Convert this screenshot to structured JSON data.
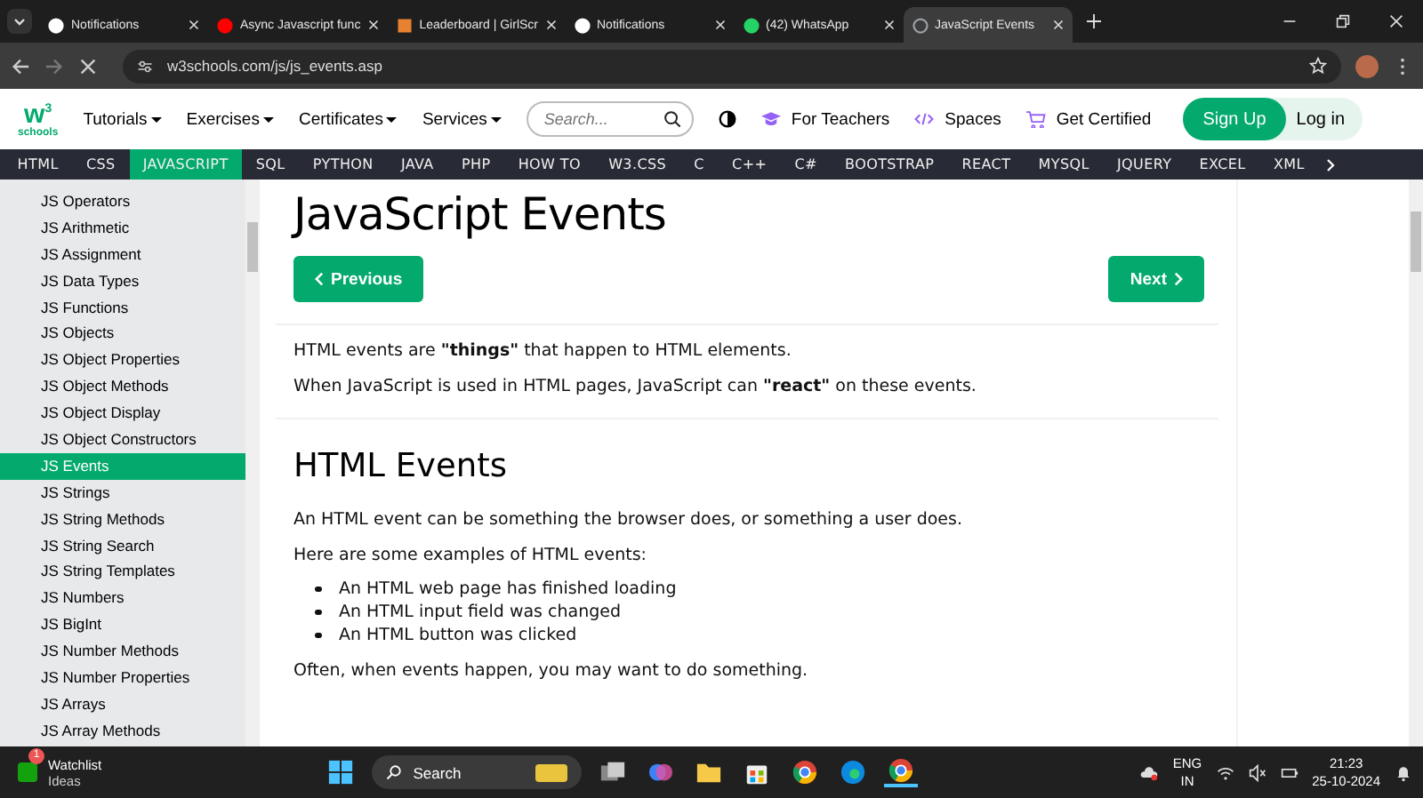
{
  "browser": {
    "tabs": [
      {
        "kind": "github",
        "title": "Notifications",
        "selected": false
      },
      {
        "kind": "youtube",
        "title": "Async Javascript func",
        "selected": false
      },
      {
        "kind": "leaderboard",
        "title": "Leaderboard | GirlScr",
        "selected": false
      },
      {
        "kind": "github",
        "title": "Notifications",
        "selected": false
      },
      {
        "kind": "whatsapp",
        "title": "(42) WhatsApp",
        "selected": false
      },
      {
        "kind": "loading",
        "title": "JavaScript Events",
        "selected": true
      }
    ],
    "url": "w3schools.com/js/js_events.asp"
  },
  "site_nav": {
    "logo_top": "w",
    "logo_sup": "3",
    "logo_bottom": "schools",
    "menus": [
      "Tutorials",
      "Exercises",
      "Certificates",
      "Services"
    ],
    "search": {
      "placeholder": "Search..."
    },
    "links": [
      {
        "kind": "teachers",
        "label": "For Teachers"
      },
      {
        "kind": "spaces",
        "label": "Spaces"
      },
      {
        "kind": "certified",
        "label": "Get Certified"
      }
    ],
    "signup": "Sign Up",
    "login": "Log in"
  },
  "topics": [
    {
      "label": "HTML",
      "selected": false
    },
    {
      "label": "CSS",
      "selected": false
    },
    {
      "label": "JAVASCRIPT",
      "selected": true
    },
    {
      "label": "SQL",
      "selected": false
    },
    {
      "label": "PYTHON",
      "selected": false
    },
    {
      "label": "JAVA",
      "selected": false
    },
    {
      "label": "PHP",
      "selected": false
    },
    {
      "label": "HOW TO",
      "selected": false
    },
    {
      "label": "W3.CSS",
      "selected": false
    },
    {
      "label": "C",
      "selected": false
    },
    {
      "label": "C++",
      "selected": false
    },
    {
      "label": "C#",
      "selected": false
    },
    {
      "label": "BOOTSTRAP",
      "selected": false
    },
    {
      "label": "REACT",
      "selected": false
    },
    {
      "label": "MYSQL",
      "selected": false
    },
    {
      "label": "JQUERY",
      "selected": false
    },
    {
      "label": "EXCEL",
      "selected": false
    },
    {
      "label": "XML",
      "selected": false
    }
  ],
  "sidebar": {
    "items": [
      {
        "label": "JS Operators",
        "selected": false
      },
      {
        "label": "JS Arithmetic",
        "selected": false
      },
      {
        "label": "JS Assignment",
        "selected": false
      },
      {
        "label": "JS Data Types",
        "selected": false
      },
      {
        "label": "JS Functions",
        "selected": false
      },
      {
        "label": "JS Objects",
        "selected": false
      },
      {
        "label": "JS Object Properties",
        "selected": false
      },
      {
        "label": "JS Object Methods",
        "selected": false
      },
      {
        "label": "JS Object Display",
        "selected": false
      },
      {
        "label": "JS Object Constructors",
        "selected": false
      },
      {
        "label": "JS Events",
        "selected": true
      },
      {
        "label": "JS Strings",
        "selected": false
      },
      {
        "label": "JS String Methods",
        "selected": false
      },
      {
        "label": "JS String Search",
        "selected": false
      },
      {
        "label": "JS String Templates",
        "selected": false
      },
      {
        "label": "JS Numbers",
        "selected": false
      },
      {
        "label": "JS BigInt",
        "selected": false
      },
      {
        "label": "JS Number Methods",
        "selected": false
      },
      {
        "label": "JS Number Properties",
        "selected": false
      },
      {
        "label": "JS Arrays",
        "selected": false
      },
      {
        "label": "JS Array Methods",
        "selected": false
      }
    ]
  },
  "article": {
    "title": "JavaScript Events",
    "prev": "Previous",
    "next": "Next",
    "intro": [
      "HTML events are **\"things\"** that happen to HTML elements.",
      "When JavaScript is used in HTML pages, JavaScript can **\"react\"** on these events."
    ],
    "heading": "HTML Events",
    "paragraphs": [
      "An HTML event can be something the browser does, or something a user does.",
      "Here are some examples of HTML events:"
    ],
    "bullets": [
      "An HTML web page has finished loading",
      "An HTML input field was changed",
      "An HTML button was clicked"
    ],
    "closing": "Often, when events happen, you may want to do something."
  },
  "taskbar": {
    "widget_title": "Watchlist",
    "widget_sub": "Ideas",
    "widget_badge": "1",
    "search": "Search",
    "lang": "ENG",
    "region": "IN",
    "time": "21:23",
    "date": "25-10-2024"
  }
}
